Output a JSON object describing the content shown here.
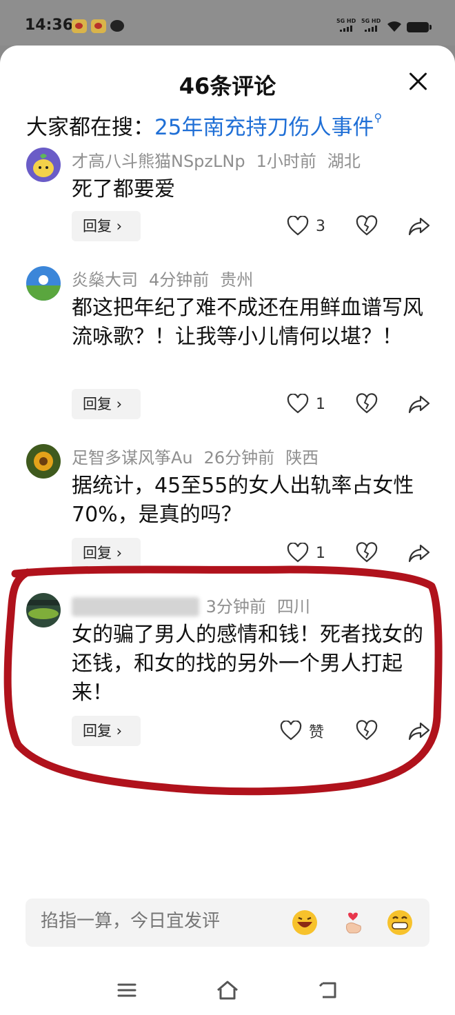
{
  "status_bar": {
    "time": "14:36",
    "network1": "5G HD",
    "network2": "5G HD"
  },
  "sheet": {
    "title": "46条评论",
    "search_prefix": "大家都在搜：",
    "search_query": "25年南充持刀伤人事件"
  },
  "comments": [
    {
      "username": "才高八斗熊猫NSpzLNp",
      "time": "1小时前",
      "location": "湖北",
      "text": "死了都要爱",
      "reply_label": "回复 ›",
      "likes": "3"
    },
    {
      "username": "炎燊大司",
      "time": "4分钟前",
      "location": "贵州",
      "text": "都这把年纪了难不成还在用鲜血谱写风流咏歌？！让我等小儿情何以堪？！",
      "reply_label": "回复 ›",
      "likes": "1"
    },
    {
      "username": "足智多谋风筝Au",
      "time": "26分钟前",
      "location": "陕西",
      "text": "据统计，45至55的女人出轨率占女性70%，是真的吗？",
      "reply_label": "回复 ›",
      "likes": "1"
    },
    {
      "username": "",
      "time": "3分钟前",
      "location": "四川",
      "text": "女的骗了男人的感情和钱！死者找女的还钱，和女的找的另外一个男人打起来！",
      "reply_label": "回复 ›",
      "likes": "赞"
    }
  ],
  "input": {
    "placeholder": "掐指一算，今日宜发评"
  },
  "colors": {
    "link": "#1f6fd6",
    "annotation": "#b0121c",
    "meta": "#8f8f8f"
  },
  "icons": [
    "close-icon",
    "search-suggest-icon",
    "heart-icon",
    "broken-heart-icon",
    "share-icon",
    "laugh-emoji-icon",
    "finger-heart-emoji-icon",
    "grin-emoji-icon",
    "menu-icon",
    "home-icon",
    "back-icon"
  ]
}
